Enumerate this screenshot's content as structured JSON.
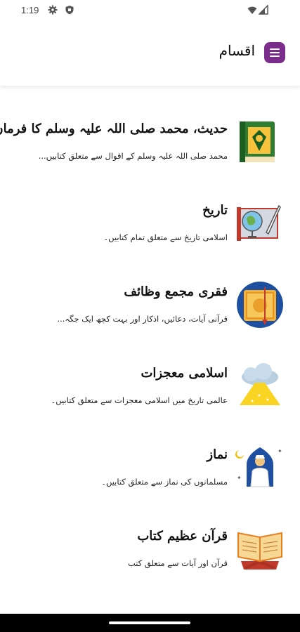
{
  "status_bar": {
    "time": "1:19"
  },
  "app_bar": {
    "title": "اقسام",
    "menu_icon": "hamburger-menu-icon",
    "accent_color": "#7b2d8b"
  },
  "categories": [
    {
      "title": "حدیث، محمد صلی اللہ علیہ وسلم کا فرمان",
      "subtitle": "محمد صلی اللہ علیہ وسلم کے اقوال سے متعلق کتابیں...",
      "icon": "quran-book-icon"
    },
    {
      "title": "تاریخ",
      "subtitle": "اسلامی تاریخ سے متعلق تمام کتابیں۔",
      "icon": "history-globe-icon"
    },
    {
      "title": "فقری مجمع وظائف",
      "subtitle": "قرآنی آیات، دعائیں، اذکار اور بہت کچھ ایک جگہ...",
      "icon": "prayer-book-icon"
    },
    {
      "title": "اسلامی معجزات",
      "subtitle": "عالمی تاریخ میں اسلامی معجزات سے متعلق کتابیں۔",
      "icon": "miracle-cloud-icon"
    },
    {
      "title": "نماز",
      "subtitle": "مسلمانوں کی نماز سے متعلق کتابیں۔",
      "icon": "praying-man-icon"
    },
    {
      "title": "قرآن عظیم کتاب",
      "subtitle": "قرآن اور آیات سے متعلق کتب",
      "icon": "open-quran-icon"
    }
  ]
}
